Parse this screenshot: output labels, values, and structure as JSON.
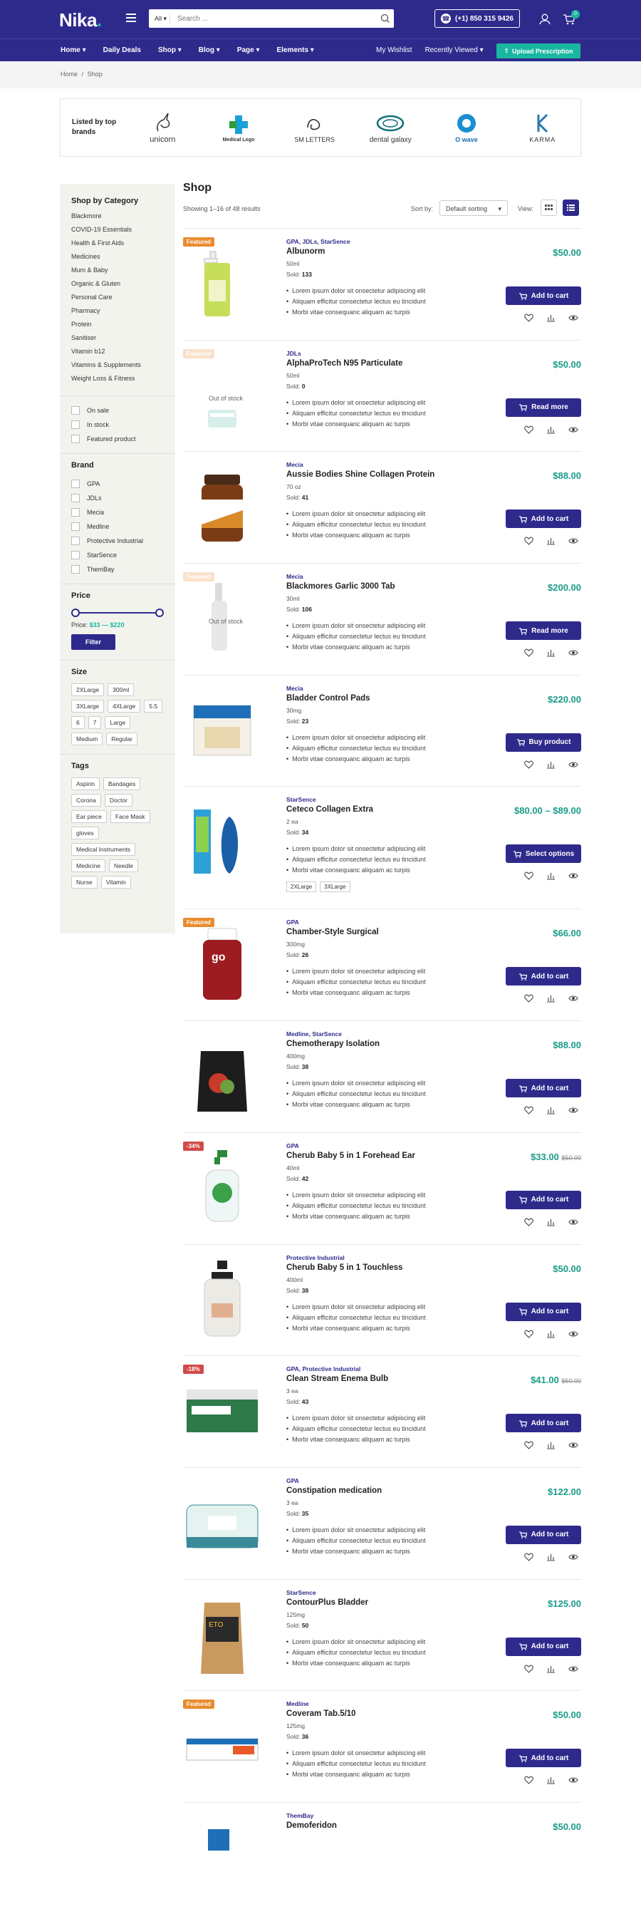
{
  "header": {
    "logo": "Nika",
    "logo_dot": ".",
    "search_category": "All",
    "search_placeholder": "Search ...",
    "phone": "(+1) 850 315 9426",
    "cart_count": "0"
  },
  "nav": {
    "left": [
      "Home",
      "Daily Deals",
      "Shop",
      "Blog",
      "Page",
      "Elements"
    ],
    "wishlist": "My Wishlist",
    "recent": "Recently Viewed",
    "upload": "Upload Prescription"
  },
  "breadcrumb": {
    "home": "Home",
    "sep": "/",
    "current": "Shop"
  },
  "brands": {
    "title": "Listed by top brands",
    "items": [
      {
        "name": "unicorn"
      },
      {
        "name": "Medical Logo"
      },
      {
        "name": "SM LETTERS"
      },
      {
        "name": "dental galaxy"
      },
      {
        "name": "O wave"
      },
      {
        "name": "KARMA"
      }
    ]
  },
  "sidebar": {
    "category_title": "Shop by Category",
    "categories": [
      "Blackmore",
      "COVID-19 Essentials",
      "Health & First Aids",
      "Medicines",
      "Mum & Baby",
      "Organic & Gluten",
      "Personal Care",
      "Pharmacy",
      "Protein",
      "Sanitiser",
      "Vitamin b12",
      "Vitamins & Supplements",
      "Weight Loss & Fitness"
    ],
    "status": [
      "On sale",
      "In stock",
      "Featured product"
    ],
    "brand_title": "Brand",
    "brand_items": [
      "GPA",
      "JDLs",
      "Mecia",
      "Medline",
      "Protective Industrial",
      "StarSence",
      "ThemBay"
    ],
    "price_title": "Price",
    "price_label": "Price:",
    "price_range": "$33 — $220",
    "filter_label": "Filter",
    "size_title": "Size",
    "sizes": [
      "2XLarge",
      "300ml",
      "3XLarge",
      "4XLarge",
      "5.5",
      "6",
      "7",
      "Large",
      "Medium",
      "Regular"
    ],
    "tags_title": "Tags",
    "tags": [
      "Aspirin",
      "Bandages",
      "Corona",
      "Doctor",
      "Ear piece",
      "Face Mask",
      "gloves",
      "Medical Instruments",
      "Medicine",
      "Needle",
      "Nurse",
      "Vitamin"
    ]
  },
  "shop": {
    "title": "Shop",
    "results": "Showing 1–16 of 48 results",
    "sort_label": "Sort by:",
    "sort_value": "Default sorting",
    "view_label": "View:"
  },
  "bullets": [
    "Lorem ipsum dolor sit onsectetur adipiscing elit",
    "Aliquam efficitur consectetur lectus eu tincidunt",
    "Morbi vitae consequanc aliquam ac turpis"
  ],
  "products": [
    {
      "badge": "Featured",
      "brand": "GPA, JDLs, StarSence",
      "title": "Albunorm",
      "attr": "50ml",
      "sold_label": "Sold:",
      "sold": "133",
      "price": "$50.00",
      "old_price": "",
      "cta": "Add to cart",
      "oos": ""
    },
    {
      "badge": "Featured",
      "brand": "JDLs",
      "title": "AlphaProTech N95 Particulate",
      "attr": "50ml",
      "sold_label": "Sold:",
      "sold": "0",
      "price": "$50.00",
      "old_price": "",
      "cta": "Read more",
      "oos": "Out of stock"
    },
    {
      "badge": "",
      "brand": "Mecia",
      "title": "Aussie Bodies Shine Collagen Protein",
      "attr": "70 oz",
      "sold_label": "Sold:",
      "sold": "41",
      "price": "$88.00",
      "old_price": "",
      "cta": "Add to cart",
      "oos": ""
    },
    {
      "badge": "Featured",
      "brand": "Mecia",
      "title": "Blackmores Garlic 3000 Tab",
      "attr": "30ml",
      "sold_label": "Sold:",
      "sold": "106",
      "price": "$200.00",
      "old_price": "",
      "cta": "Read more",
      "oos": "Out of stock"
    },
    {
      "badge": "",
      "brand": "Mecia",
      "title": "Bladder Control Pads",
      "attr": "30mg",
      "sold_label": "Sold:",
      "sold": "23",
      "price": "$220.00",
      "old_price": "",
      "cta": "Buy product",
      "oos": ""
    },
    {
      "badge": "",
      "brand": "StarSence",
      "title": "Ceteco Collagen Extra",
      "attr": "2 ea",
      "sold_label": "Sold:",
      "sold": "34",
      "price": "$80.00 – $89.00",
      "old_price": "",
      "cta": "Select options",
      "oos": "",
      "sizes": [
        "2XLarge",
        "3XLarge"
      ]
    },
    {
      "badge": "Featured",
      "brand": "GPA",
      "title": "Chamber-Style Surgical",
      "attr": "300mg",
      "sold_label": "Sold:",
      "sold": "26",
      "price": "$66.00",
      "old_price": "",
      "cta": "Add to cart",
      "oos": ""
    },
    {
      "badge": "",
      "brand": "Medline, StarSence",
      "title": "Chemotherapy Isolation",
      "attr": "400mg",
      "sold_label": "Sold:",
      "sold": "38",
      "price": "$88.00",
      "old_price": "",
      "cta": "Add to cart",
      "oos": ""
    },
    {
      "badge": "-34%",
      "brand": "GPA",
      "title": "Cherub Baby 5 in 1 Forehead Ear",
      "attr": "40ml",
      "sold_label": "Sold:",
      "sold": "42",
      "price": "$33.00",
      "old_price": "$50.00",
      "cta": "Add to cart",
      "oos": ""
    },
    {
      "badge": "",
      "brand": "Protective Industrial",
      "title": "Cherub Baby 5 in 1 Touchless",
      "attr": "400ml",
      "sold_label": "Sold:",
      "sold": "38",
      "price": "$50.00",
      "old_price": "",
      "cta": "Add to cart",
      "oos": ""
    },
    {
      "badge": "-18%",
      "brand": "GPA, Protective Industrial",
      "title": "Clean Stream Enema Bulb",
      "attr": "3 ea",
      "sold_label": "Sold:",
      "sold": "43",
      "price": "$41.00",
      "old_price": "$50.00",
      "cta": "Add to cart",
      "oos": ""
    },
    {
      "badge": "",
      "brand": "GPA",
      "title": "Constipation medication",
      "attr": "3 ea",
      "sold_label": "Sold:",
      "sold": "35",
      "price": "$122.00",
      "old_price": "",
      "cta": "Add to cart",
      "oos": ""
    },
    {
      "badge": "",
      "brand": "StarSence",
      "title": "ContourPlus Bladder",
      "attr": "125mg",
      "sold_label": "Sold:",
      "sold": "50",
      "price": "$125.00",
      "old_price": "",
      "cta": "Add to cart",
      "oos": ""
    },
    {
      "badge": "Featured",
      "brand": "Medline",
      "title": "Coveram Tab.5/10",
      "attr": "125mg",
      "sold_label": "Sold:",
      "sold": "36",
      "price": "$50.00",
      "old_price": "",
      "cta": "Add to cart",
      "oos": ""
    },
    {
      "badge": "",
      "brand": "ThemBay",
      "title": "Demoferidon",
      "attr": "",
      "sold_label": "",
      "sold": "",
      "price": "$50.00",
      "old_price": "",
      "cta": "",
      "oos": ""
    }
  ],
  "colors": {
    "primary": "#2e2a8c",
    "accent": "#1ab7a0",
    "price": "#1a9c8c",
    "featured": "#e98c2f",
    "sale": "#d14a4a"
  }
}
